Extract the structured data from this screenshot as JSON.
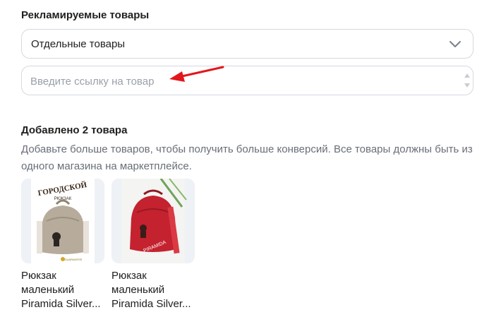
{
  "promoted": {
    "title": "Рекламируемые товары",
    "select_value": "Отдельные товары",
    "link_placeholder": "Введите ссылку на товар"
  },
  "added": {
    "title": "Добавлено 2 товара",
    "description": "Добавьте больше товаров, чтобы получить больше конверсий. Все товары должны быть из одного магазина на маркетплейсе."
  },
  "products": [
    {
      "title_lines": [
        "Рюкзак",
        "маленький",
        "Piramida Silver..."
      ],
      "image_text_1": "ГОРОДСКОЙ",
      "image_text_2": "РЮКЗАК",
      "image_text_3": "GUARANTEE",
      "color": "#b7ab9b"
    },
    {
      "title_lines": [
        "Рюкзак",
        "маленький",
        "Piramida Silver..."
      ],
      "image_text_1": "PIRAMIDA",
      "color": "#c4222f"
    }
  ],
  "colors": {
    "annotation_arrow": "#e3171b",
    "border": "#d5d9df",
    "placeholder": "#9aa0a9"
  }
}
